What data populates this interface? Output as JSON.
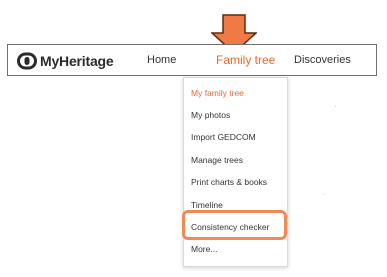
{
  "colors": {
    "accent": "#e96a32",
    "callout": "#f07a45",
    "callout_border": "#5a2a10",
    "highlight": "#f08a55"
  },
  "brand": {
    "name": "MyHeritage",
    "logo_icon": "myheritage-logo-icon"
  },
  "nav": {
    "home": "Home",
    "family_tree": "Family tree",
    "discoveries": "Discoveries",
    "active": "Family tree"
  },
  "menu": {
    "items": [
      {
        "label": "My family tree",
        "active": true
      },
      {
        "label": "My photos",
        "active": false
      },
      {
        "label": "Import GEDCOM",
        "active": false
      },
      {
        "label": "Manage trees",
        "active": false
      },
      {
        "label": "Print charts & books",
        "active": false
      },
      {
        "label": "Timeline",
        "active": false
      },
      {
        "label": "Consistency checker",
        "active": false,
        "highlighted": true
      },
      {
        "label": "More...",
        "active": false
      }
    ]
  },
  "annotations": {
    "callout_arrow_icon": "down-arrow-callout-icon",
    "highlight_target": "Consistency checker"
  }
}
